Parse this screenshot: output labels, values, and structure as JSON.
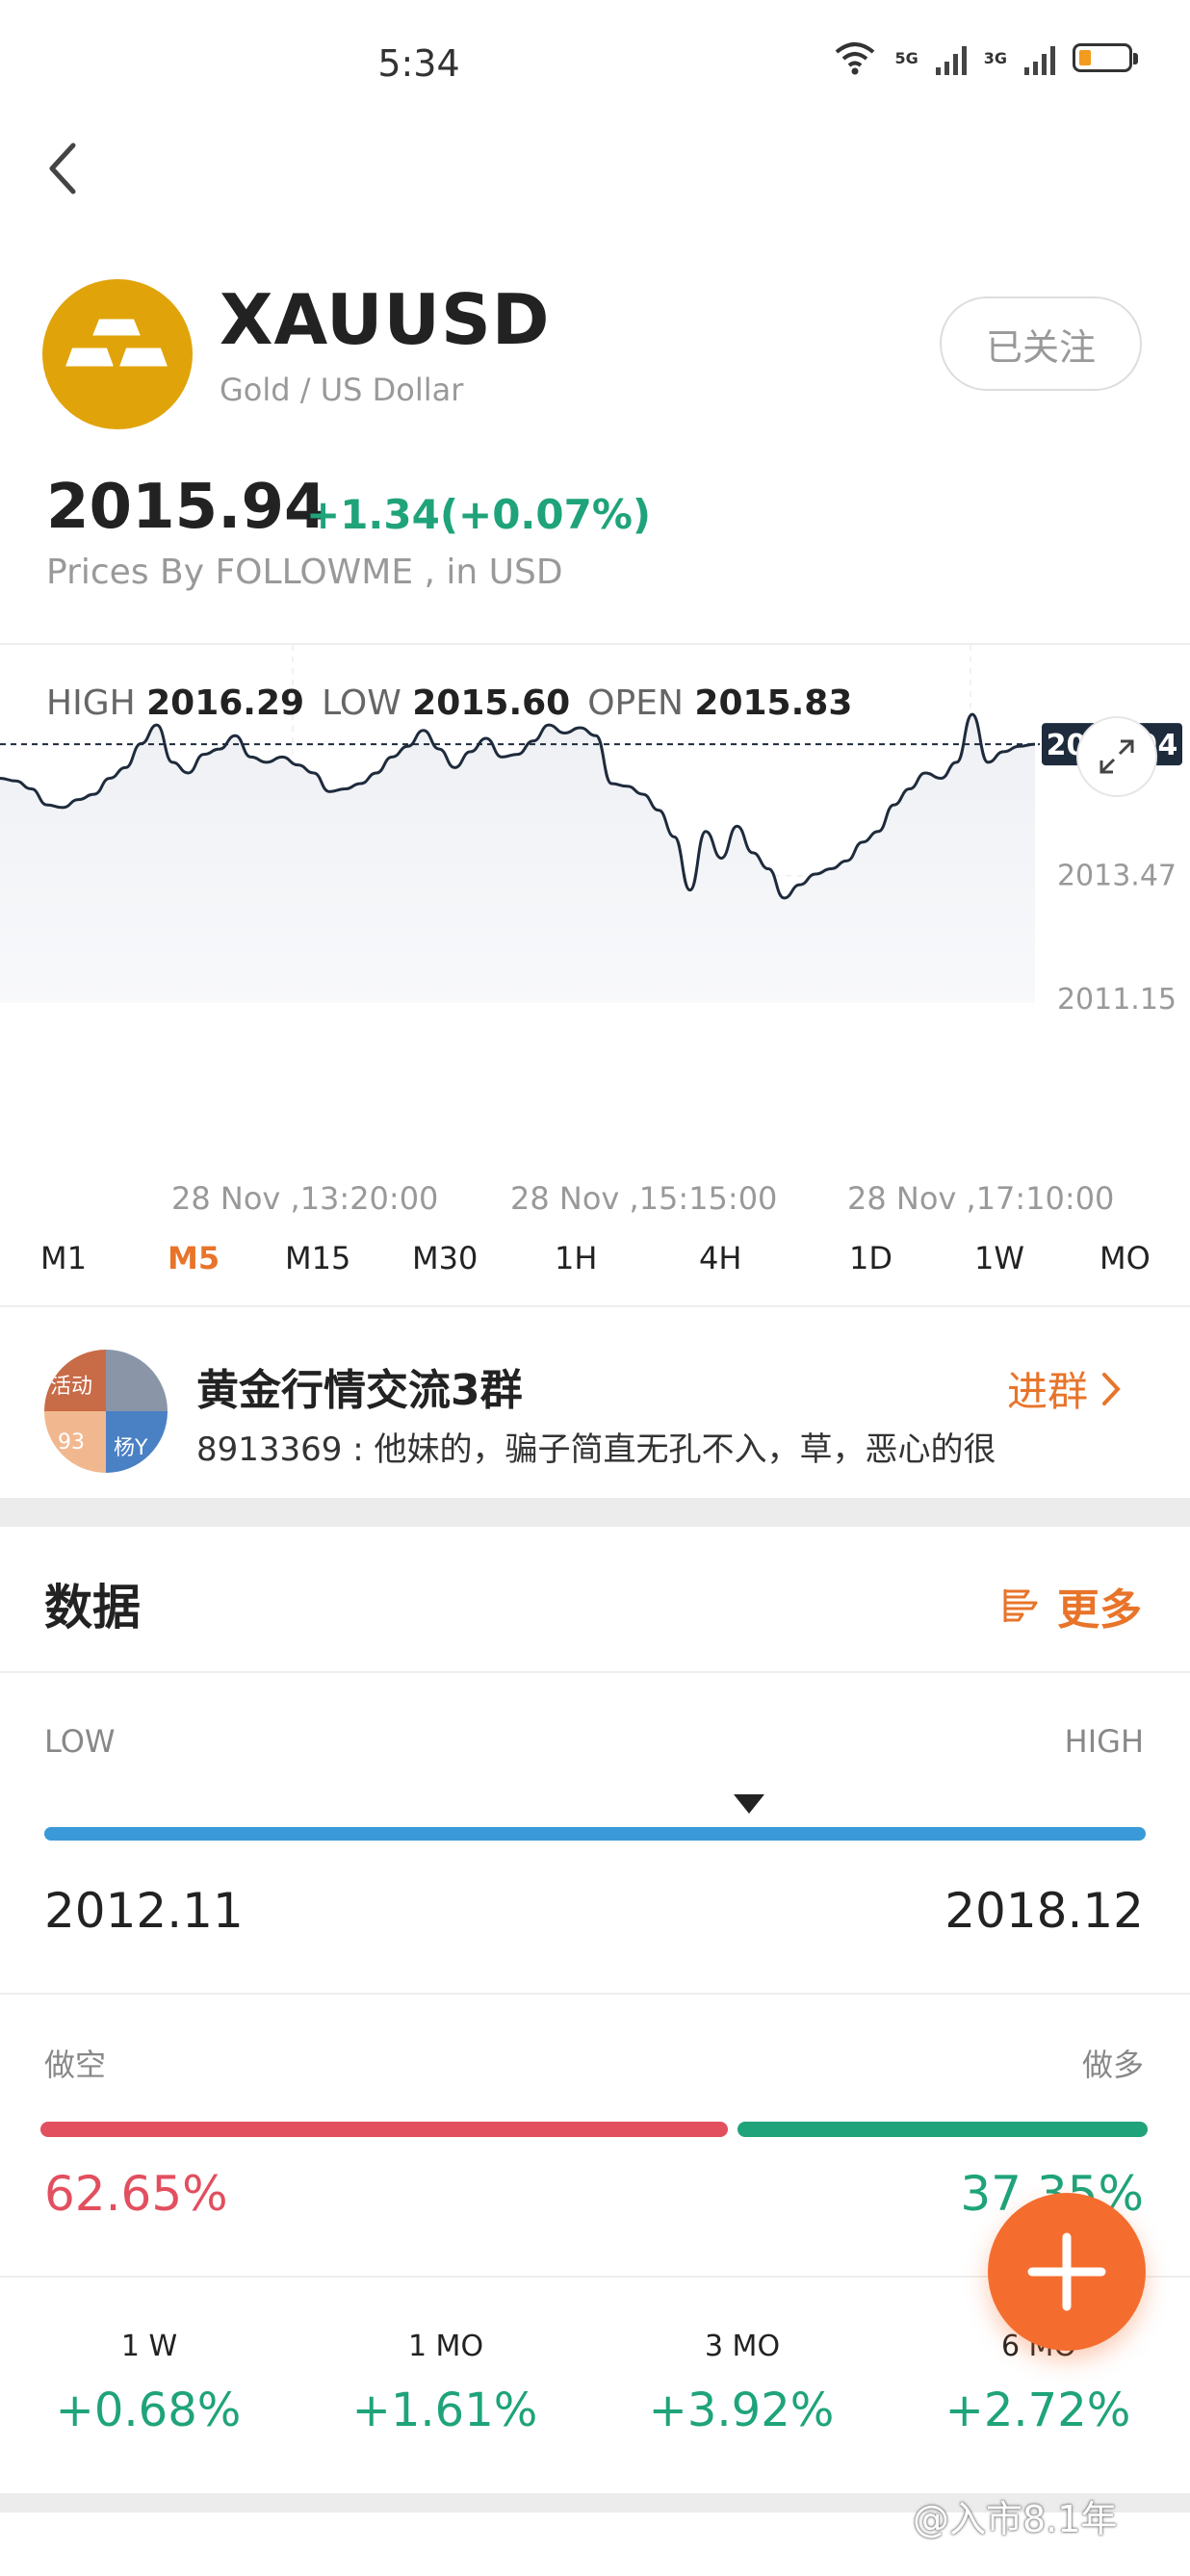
{
  "status_bar": {
    "time": "5:34",
    "signal1": "5G",
    "signal2": "3G",
    "wifi": "6"
  },
  "header": {
    "symbol": "XAUUSD",
    "name": "Gold / US Dollar",
    "follow_label": "已关注"
  },
  "quote": {
    "price": "2015.94",
    "change": "+1.34(+0.07%)",
    "source": "Prices By FOLLOWME , in USD"
  },
  "chart_stats": {
    "high_label": "HIGH",
    "high_value": "2016.29",
    "low_label": "LOW",
    "low_value": "2015.60",
    "open_label": "OPEN",
    "open_value": "2015.83"
  },
  "chart_data": {
    "type": "area",
    "x_ticks": [
      "28 Nov ,13:20:00",
      "28 Nov ,15:15:00",
      "28 Nov ,17:10:00"
    ],
    "y_ticks": [
      "2013.47",
      "2011.15"
    ],
    "current_price_label": "2015.94",
    "current_price": 2015.94,
    "ylim": [
      2011.15,
      2016.9
    ],
    "series": [
      {
        "values": [
          2015.3,
          2015.25,
          2015.1,
          2014.8,
          2014.75,
          2014.9,
          2015.0,
          2015.3,
          2015.5,
          2015.95,
          2016.3,
          2015.6,
          2015.4,
          2015.75,
          2015.85,
          2016.1,
          2015.7,
          2015.6,
          2015.7,
          2015.55,
          2015.4,
          2015.05,
          2015.1,
          2015.2,
          2015.4,
          2015.7,
          2015.9,
          2016.2,
          2015.85,
          2015.5,
          2015.8,
          2016.05,
          2015.7,
          2015.75,
          2016.0,
          2016.3,
          2016.15,
          2016.25,
          2016.1,
          2015.2,
          2015.15,
          2015.0,
          2014.7,
          2014.2,
          2013.2,
          2014.3,
          2013.8,
          2014.4,
          2013.9,
          2013.6,
          2013.05,
          2013.3,
          2013.5,
          2013.6,
          2013.75,
          2014.1,
          2014.3,
          2014.8,
          2015.1,
          2015.4,
          2015.3,
          2015.6,
          2016.5,
          2015.6,
          2015.8,
          2015.9,
          2015.94
        ]
      }
    ]
  },
  "timeframes": [
    "M1",
    "M5",
    "M15",
    "M30",
    "1H",
    "4H",
    "1D",
    "1W",
    "MO"
  ],
  "active_timeframe": "M5",
  "group": {
    "name": "黄金行情交流3群",
    "message": "8913369 : 他妹的，骗子简直无孔不入，草，恶心的很",
    "join_label": "进群",
    "avatar_tags": [
      "活动",
      "93",
      "杨Y"
    ]
  },
  "data_section": {
    "title": "数据",
    "more_label": "更多",
    "range": {
      "low_label": "LOW",
      "high_label": "HIGH",
      "low_value": "2012.11",
      "high_value": "2018.12",
      "marker_position": 0.64
    },
    "sentiment": {
      "short_label": "做空",
      "long_label": "做多",
      "short_pct": "62.65%",
      "long_pct": "37.35%",
      "short_fraction": 0.6265
    },
    "performance": [
      {
        "label": "1 W",
        "value": "+0.68%"
      },
      {
        "label": "1 MO",
        "value": "+1.61%"
      },
      {
        "label": "3 MO",
        "value": "+3.92%"
      },
      {
        "label": "6 MO",
        "value": "+2.72%"
      }
    ]
  },
  "watermark": "@入市8.1年",
  "colors": {
    "accent": "#e8742a",
    "up": "#1fa37a",
    "down": "#e24f5f",
    "range_bar": "#3a9ad9",
    "logo": "#e0a40a"
  }
}
